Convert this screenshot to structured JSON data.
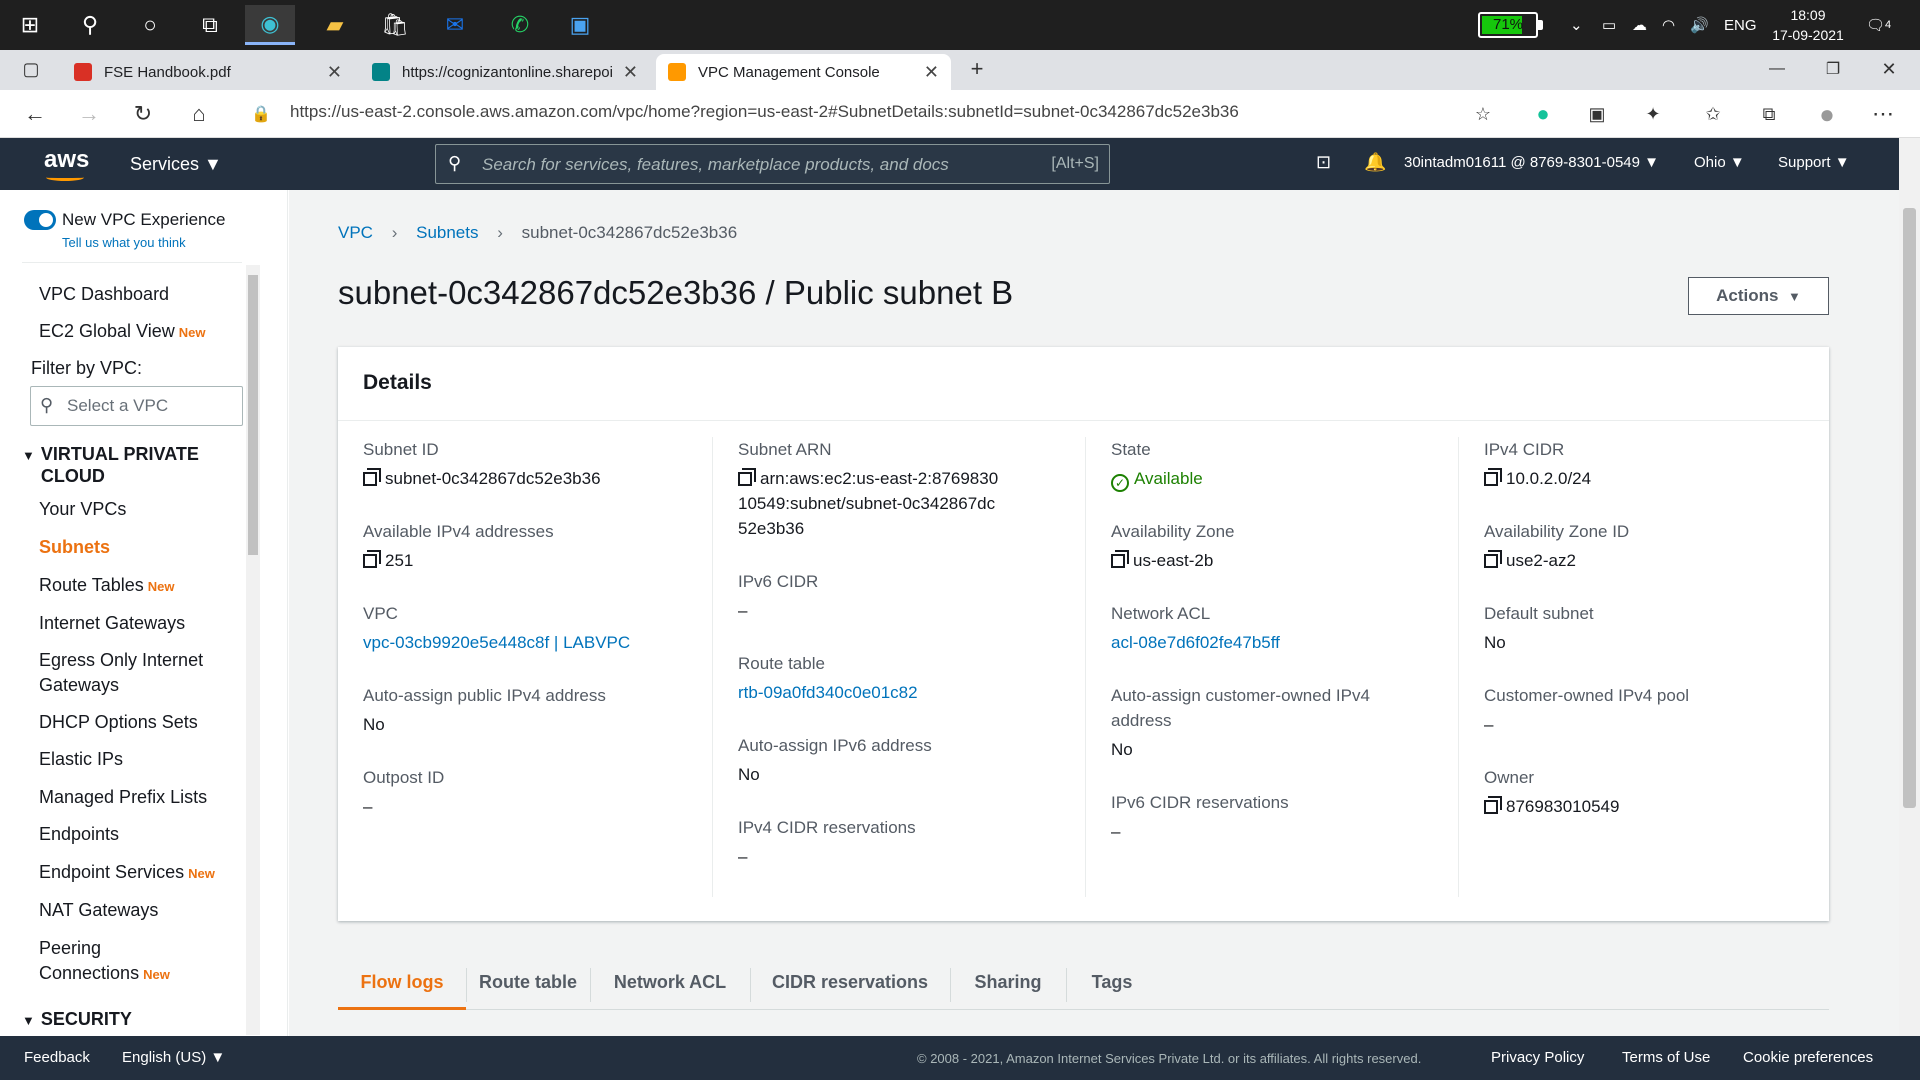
{
  "taskbar": {
    "battery": "71%",
    "lang": "ENG",
    "time": "18:09",
    "date": "17-09-2021",
    "notifications": "4"
  },
  "browser": {
    "tabs": [
      {
        "title": "FSE Handbook.pdf"
      },
      {
        "title": "https://cognizantonline.sharepoi"
      },
      {
        "title": "VPC Management Console"
      }
    ],
    "url": "https://us-east-2.console.aws.amazon.com/vpc/home?region=us-east-2#SubnetDetails:subnetId=subnet-0c342867dc52e3b36"
  },
  "awsnav": {
    "logo": "aws",
    "services": "Services",
    "search_placeholder": "Search for services, features, marketplace products, and docs",
    "search_shortcut": "[Alt+S]",
    "account": "30intadm01611 @ 8769-8301-0549",
    "region": "Ohio",
    "support": "Support"
  },
  "sidebar": {
    "experience": "New VPC Experience",
    "feedback": "Tell us what you think",
    "dashboard": "VPC Dashboard",
    "ec2_global": "EC2 Global View",
    "new_badge": "New",
    "filter_label": "Filter by VPC:",
    "select_placeholder": "Select a VPC",
    "section_vpc": "VIRTUAL PRIVATE CLOUD",
    "items": {
      "your_vpcs": "Your VPCs",
      "subnets": "Subnets",
      "route_tables": "Route Tables",
      "internet_gateways": "Internet Gateways",
      "egress": "Egress Only Internet Gateways",
      "dhcp": "DHCP Options Sets",
      "elastic_ips": "Elastic IPs",
      "prefix_lists": "Managed Prefix Lists",
      "endpoints": "Endpoints",
      "endpoint_services": "Endpoint Services",
      "nat": "NAT Gateways",
      "peering": "Peering Connections"
    },
    "section_security": "SECURITY"
  },
  "main": {
    "breadcrumb": {
      "vpc": "VPC",
      "subnets": "Subnets",
      "current": "subnet-0c342867dc52e3b36"
    },
    "title": "subnet-0c342867dc52e3b36 / Public subnet B",
    "actions": "Actions",
    "details_title": "Details",
    "fields": {
      "subnet_id": {
        "label": "Subnet ID",
        "value": "subnet-0c342867dc52e3b36"
      },
      "avail_ipv4": {
        "label": "Available IPv4 addresses",
        "value": "251"
      },
      "vpc": {
        "label": "VPC",
        "value": "vpc-03cb9920e5e448c8f | LABVPC"
      },
      "auto_public": {
        "label": "Auto-assign public IPv4 address",
        "value": "No"
      },
      "outpost": {
        "label": "Outpost ID",
        "value": "–"
      },
      "arn": {
        "label": "Subnet ARN",
        "value": "arn:aws:ec2:us-east-2:876983010549:subnet/subnet-0c342867dc52e3b36"
      },
      "ipv6_cidr": {
        "label": "IPv6 CIDR",
        "value": "–"
      },
      "route_table": {
        "label": "Route table",
        "value": "rtb-09a0fd340c0e01c82"
      },
      "auto_ipv6": {
        "label": "Auto-assign IPv6 address",
        "value": "No"
      },
      "ipv4_res": {
        "label": "IPv4 CIDR reservations",
        "value": "–"
      },
      "state": {
        "label": "State",
        "value": "Available"
      },
      "az": {
        "label": "Availability Zone",
        "value": "us-east-2b"
      },
      "nacl": {
        "label": "Network ACL",
        "value": "acl-08e7d6f02fe47b5ff"
      },
      "auto_cust": {
        "label": "Auto-assign customer-owned IPv4 address",
        "value": "No"
      },
      "ipv6_res": {
        "label": "IPv6 CIDR reservations",
        "value": "–"
      },
      "ipv4_cidr": {
        "label": "IPv4 CIDR",
        "value": "10.0.2.0/24"
      },
      "az_id": {
        "label": "Availability Zone ID",
        "value": "use2-az2"
      },
      "default": {
        "label": "Default subnet",
        "value": "No"
      },
      "cust_pool": {
        "label": "Customer-owned IPv4 pool",
        "value": "–"
      },
      "owner": {
        "label": "Owner",
        "value": "876983010549"
      }
    },
    "tabs": [
      "Flow logs",
      "Route table",
      "Network ACL",
      "CIDR reservations",
      "Sharing",
      "Tags"
    ]
  },
  "footer": {
    "feedback": "Feedback",
    "language": "English (US)",
    "copyright": "© 2008 - 2021, Amazon Internet Services Private Ltd. or its affiliates. All rights reserved.",
    "privacy": "Privacy Policy",
    "terms": "Terms of Use",
    "cookies": "Cookie preferences"
  }
}
